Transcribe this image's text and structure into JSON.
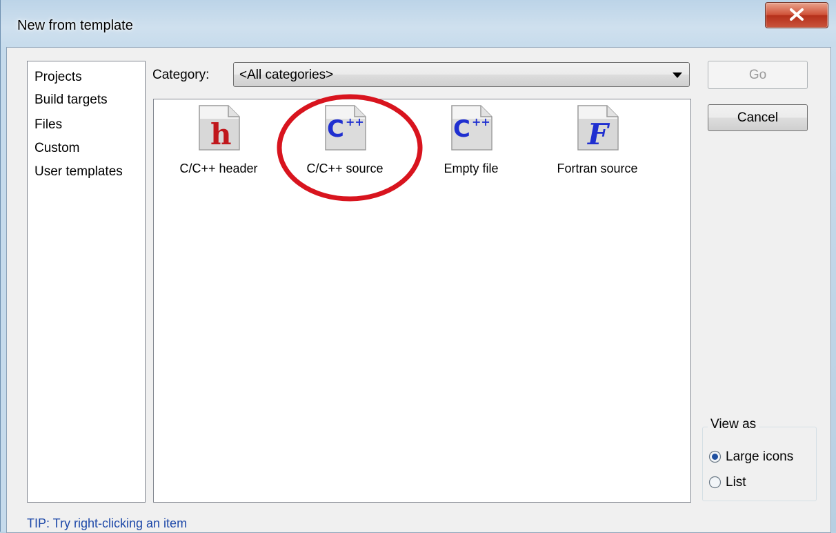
{
  "window": {
    "title": "New from template",
    "close_glyph": "X"
  },
  "left_list": {
    "items": [
      {
        "label": "Projects"
      },
      {
        "label": "Build targets"
      },
      {
        "label": "Files"
      },
      {
        "label": "Custom"
      },
      {
        "label": "User templates"
      }
    ],
    "selected": "Files"
  },
  "category": {
    "label": "Category:",
    "value": "<All categories>"
  },
  "templates": [
    {
      "label": "C/C++ header",
      "icon": "h-file-icon",
      "glyph": "h",
      "color": "#c0171c"
    },
    {
      "label": "C/C++ source",
      "icon": "cpp-file-icon",
      "glyph": "C",
      "color": "#1f2fd0"
    },
    {
      "label": "Empty file",
      "icon": "cpp-file-icon",
      "glyph": "C",
      "color": "#1f2fd0"
    },
    {
      "label": "Fortran source",
      "icon": "fortran-file-icon",
      "glyph": "F",
      "color": "#1f2fd0"
    }
  ],
  "annotation": {
    "highlight": "C/C++ source",
    "color": "#d8141e"
  },
  "buttons": {
    "go": "Go",
    "cancel": "Cancel"
  },
  "view_as": {
    "title": "View as",
    "options": [
      {
        "label": "Large icons",
        "checked": true
      },
      {
        "label": "List",
        "checked": false
      }
    ]
  },
  "tip": "TIP: Try right-clicking an item",
  "colors": {
    "title_bar": "#bcd4e8",
    "dialog_bg": "#f0f0f0",
    "close_button": "#c9442b",
    "tip_text": "#1c47a8"
  }
}
